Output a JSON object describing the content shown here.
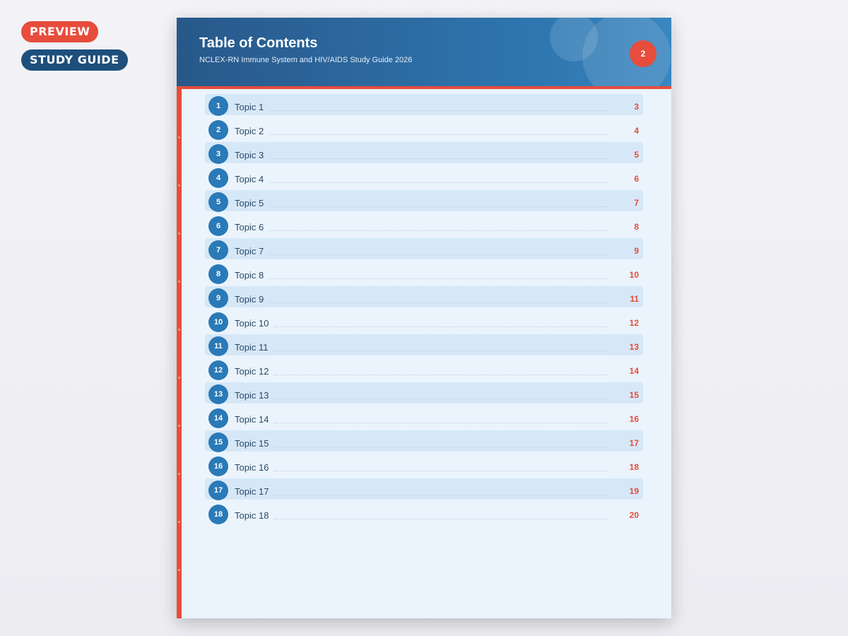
{
  "badges": {
    "preview": "PREVIEW",
    "study_guide": "STUDY GUIDE"
  },
  "header": {
    "title": "Table of Contents",
    "subtitle": "NCLEX-RN Immune System and HIV/AIDS Study Guide 2026",
    "page_number": "2"
  },
  "colors": {
    "accent": "#e74c3c",
    "primary": "#2a7ab8",
    "header_dark": "#28588a"
  },
  "toc": [
    {
      "num": "1",
      "title": "Topic 1",
      "page": "3"
    },
    {
      "num": "2",
      "title": "Topic 2",
      "page": "4"
    },
    {
      "num": "3",
      "title": "Topic 3",
      "page": "5"
    },
    {
      "num": "4",
      "title": "Topic 4",
      "page": "6"
    },
    {
      "num": "5",
      "title": "Topic 5",
      "page": "7"
    },
    {
      "num": "6",
      "title": "Topic 6",
      "page": "8"
    },
    {
      "num": "7",
      "title": "Topic 7",
      "page": "9"
    },
    {
      "num": "8",
      "title": "Topic 8",
      "page": "10"
    },
    {
      "num": "9",
      "title": "Topic 9",
      "page": "11"
    },
    {
      "num": "10",
      "title": "Topic 10",
      "page": "12"
    },
    {
      "num": "11",
      "title": "Topic 11",
      "page": "13"
    },
    {
      "num": "12",
      "title": "Topic 12",
      "page": "14"
    },
    {
      "num": "13",
      "title": "Topic 13",
      "page": "15"
    },
    {
      "num": "14",
      "title": "Topic 14",
      "page": "16"
    },
    {
      "num": "15",
      "title": "Topic 15",
      "page": "17"
    },
    {
      "num": "16",
      "title": "Topic 16",
      "page": "18"
    },
    {
      "num": "17",
      "title": "Topic 17",
      "page": "19"
    },
    {
      "num": "18",
      "title": "Topic 18",
      "page": "20"
    }
  ]
}
